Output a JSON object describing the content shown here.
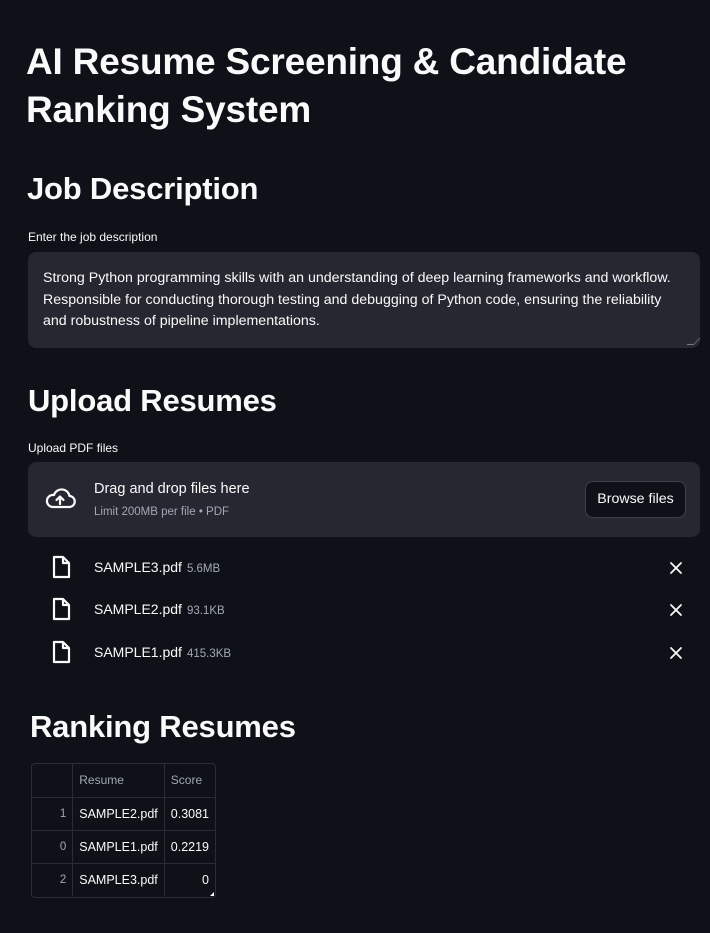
{
  "title": "AI Resume Screening & Candidate Ranking System",
  "job_section": {
    "header": "Job Description",
    "input_label": "Enter the job description",
    "input_value": "Strong Python programming skills with an understanding of deep learning frameworks and workflow. Responsible for conducting thorough testing and debugging of Python code, ensuring the reliability and robustness of pipeline implementations."
  },
  "upload_section": {
    "header": "Upload Resumes",
    "input_label": "Upload PDF files",
    "dropzone_text": "Drag and drop files here",
    "dropzone_limit": "Limit 200MB per file • PDF",
    "browse_label": "Browse files",
    "files": [
      {
        "name": "SAMPLE3.pdf",
        "size": "5.6MB"
      },
      {
        "name": "SAMPLE2.pdf",
        "size": "93.1KB"
      },
      {
        "name": "SAMPLE1.pdf",
        "size": "415.3KB"
      }
    ],
    "upload_icon": "cloud-upload-icon",
    "file_icon": "document-icon",
    "remove_icon": "close-icon"
  },
  "ranking_section": {
    "header": "Ranking Resumes",
    "columns": [
      "Resume",
      "Score"
    ],
    "rows": [
      {
        "index": "1",
        "resume": "SAMPLE2.pdf",
        "score": "0.3081"
      },
      {
        "index": "0",
        "resume": "SAMPLE1.pdf",
        "score": "0.2219"
      },
      {
        "index": "2",
        "resume": "SAMPLE3.pdf",
        "score": "0"
      }
    ]
  },
  "colors": {
    "background": "#0e1117",
    "widget_bg": "#262730",
    "text": "#fafafa",
    "muted_text": "#a3a8b4"
  }
}
